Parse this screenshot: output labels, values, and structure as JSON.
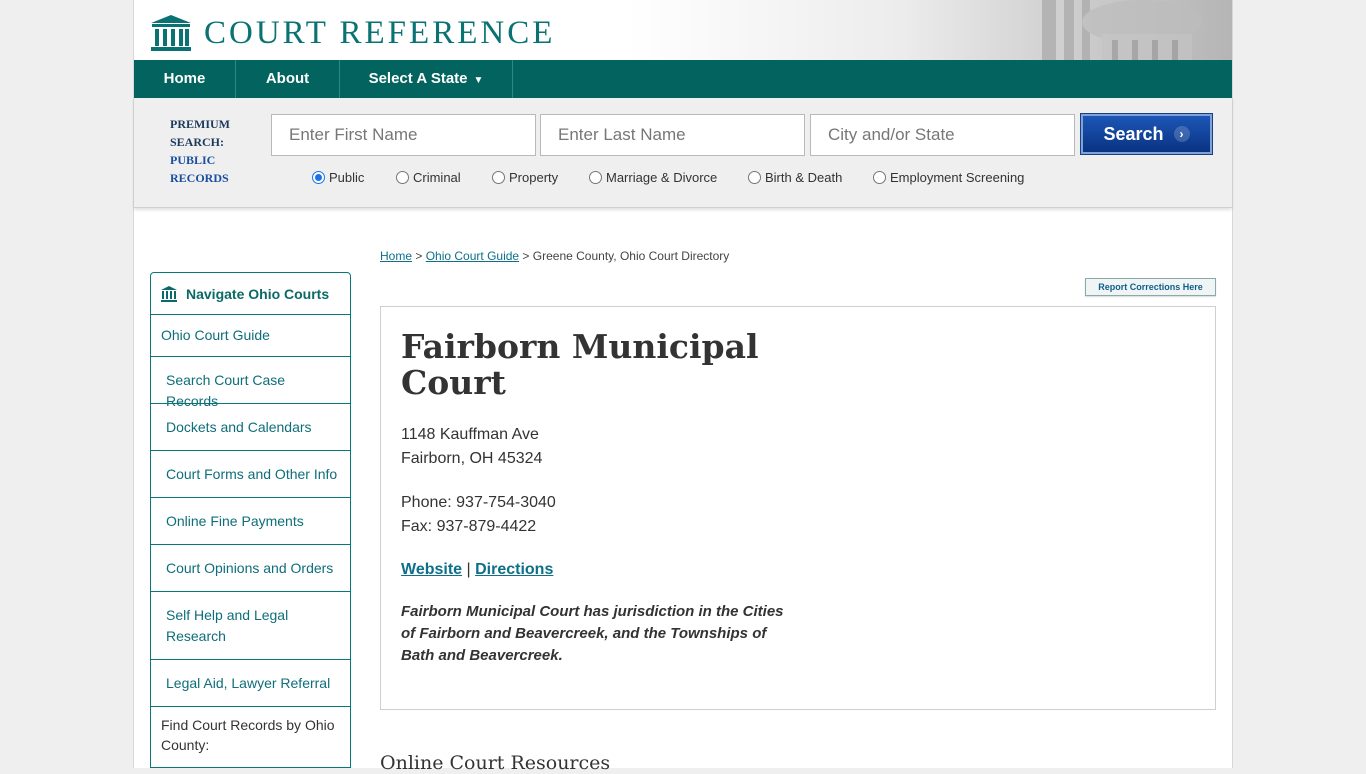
{
  "brand": {
    "logo_text": "COURT REFERENCE",
    "accent": "#03645f"
  },
  "nav": {
    "home": "Home",
    "about": "About",
    "state": "Select A State",
    "caret": "▼"
  },
  "search": {
    "label_line1": "PREMIUM",
    "label_line2": "SEARCH:",
    "label_line3": "PUBLIC",
    "label_line4": "RECORDS",
    "first_name_placeholder": "Enter First Name",
    "last_name_placeholder": "Enter Last Name",
    "city_state_placeholder": "City and/or State",
    "button_label": "Search",
    "button_chevron": "›",
    "options": [
      {
        "label": "Public",
        "checked": true
      },
      {
        "label": "Criminal",
        "checked": false
      },
      {
        "label": "Property",
        "checked": false
      },
      {
        "label": "Marriage & Divorce",
        "checked": false
      },
      {
        "label": "Birth & Death",
        "checked": false
      },
      {
        "label": "Employment Screening",
        "checked": false
      }
    ]
  },
  "sidebar": {
    "title": "Navigate Ohio Courts",
    "guide": "Ohio Court Guide",
    "items": [
      "Search Court Case Records",
      "Dockets and Calendars",
      "Court Forms and Other Info",
      "Online Fine Payments",
      "Court Opinions and Orders",
      "Self Help and Legal Research",
      "Legal Aid, Lawyer Referral"
    ],
    "footer": "Find Court Records by Ohio County:"
  },
  "breadcrumb": {
    "home": "Home",
    "sep1": " > ",
    "guide": "Ohio Court Guide",
    "sep2": " > ",
    "current": "Greene County, Ohio Court Directory"
  },
  "report_button": "Report Corrections Here",
  "court": {
    "name": "Fairborn Municipal Court",
    "street": "1148 Kauffman Ave",
    "city_line": "Fairborn, OH 45324",
    "phone": "Phone: 937-754-3040",
    "fax": "Fax: 937-879-4422",
    "website_label": "Website",
    "link_sep": " | ",
    "directions_label": "Directions",
    "description": "Fairborn Municipal Court has jurisdiction in the Cities of Fairborn and Beavercreek, and the Townships of Bath and Beavercreek."
  },
  "resources_heading": "Online Court Resources"
}
